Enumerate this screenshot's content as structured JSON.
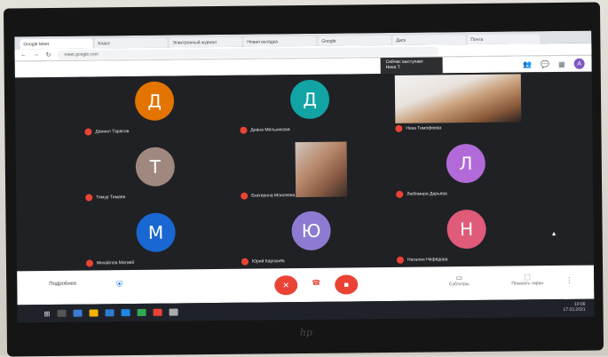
{
  "browser": {
    "tabs": [
      {
        "label": "Google Meet"
      },
      {
        "label": "Класс"
      },
      {
        "label": "Электронный журнал"
      },
      {
        "label": "Новая вкладка"
      },
      {
        "label": "Google"
      },
      {
        "label": "Диск"
      },
      {
        "label": "Почта"
      }
    ],
    "url": "meet.google.com"
  },
  "meet": {
    "header_info_line1": "Сейчас выступает",
    "header_info_line2": "Ника Т.",
    "profile_initial": "А",
    "participants": [
      {
        "initial": "Д",
        "name": "Даниил Тарасов",
        "color": "#e37400",
        "type": "avatar"
      },
      {
        "initial": "Д",
        "name": "Диана Мельникова",
        "color": "#12a4a4",
        "type": "avatar"
      },
      {
        "initial": "",
        "name": "Ника Тимофеева",
        "color": "",
        "type": "video"
      },
      {
        "initial": "Т",
        "name": "Тимур Тимаев",
        "color": "#a1887f",
        "type": "avatar"
      },
      {
        "initial": "",
        "name": "Екатерина Моисеева",
        "color": "",
        "type": "video"
      },
      {
        "initial": "Л",
        "name": "Любомира Дарьева",
        "color": "#b26ad8",
        "type": "avatar"
      },
      {
        "initial": "М",
        "name": "Михайлов Матвей",
        "color": "#1967d2",
        "type": "avatar"
      },
      {
        "initial": "Ю",
        "name": "Юрий Карпачёв",
        "color": "#8e7bd1",
        "type": "avatar"
      },
      {
        "initial": "Н",
        "name": "Наталия Нефёдова",
        "color": "#e05a79",
        "type": "avatar"
      }
    ],
    "controls": {
      "meeting_details": "Подробнее",
      "mic_icon": "mic-off-icon",
      "hangup_icon": "phone-icon",
      "camera_icon": "camera-off-icon",
      "captions_label": "Субтитры",
      "present_label": "Показать экран"
    }
  },
  "taskbar": {
    "time": "10:06",
    "date": "17.03.2021"
  },
  "colors": {
    "meet_bg": "#202124",
    "mic_off": "#ea4335",
    "accent": "#1a73e8"
  }
}
